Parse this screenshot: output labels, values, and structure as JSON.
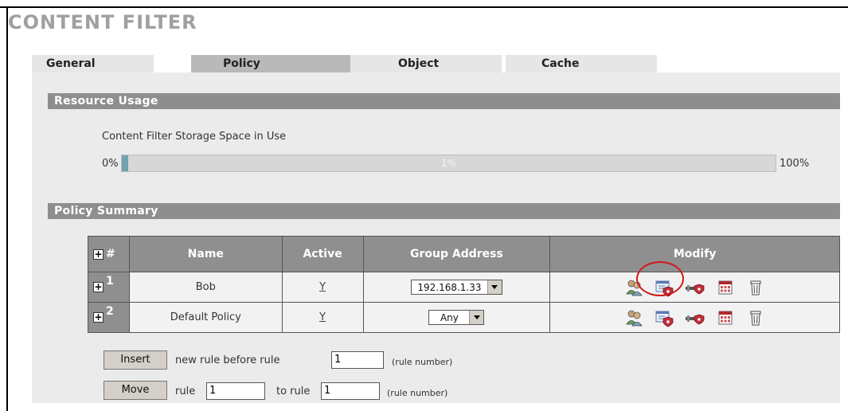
{
  "window": {
    "title": "CONTENT FILTER"
  },
  "tabs": [
    {
      "label": "General"
    },
    {
      "label": "Policy"
    },
    {
      "label": "Object"
    },
    {
      "label": "Cache"
    }
  ],
  "resource_usage": {
    "title": "Resource Usage",
    "storage_label": "Content Filter Storage Space in Use",
    "min_label": "0%",
    "max_label": "100%",
    "percent_text": "1%",
    "percent_value": 1
  },
  "policy_summary": {
    "title": "Policy Summary",
    "columns": {
      "num": "#",
      "name": "Name",
      "active": "Active",
      "group_address": "Group Address",
      "modify": "Modify"
    },
    "rows": [
      {
        "num": "1",
        "name": "Bob",
        "active": "Y",
        "group_address": "192.168.1.33"
      },
      {
        "num": "2",
        "name": "Default Policy",
        "active": "Y",
        "group_address": "Any"
      }
    ],
    "modify_icons": [
      "users-icon",
      "policy-schedule-icon",
      "key-security-icon",
      "calendar-icon",
      "trash-icon"
    ]
  },
  "insert_row": {
    "button": "Insert",
    "text": "new rule before rule",
    "value": "1",
    "hint": "(rule number)"
  },
  "move_row": {
    "button": "Move",
    "text_rule": "rule",
    "value_from": "1",
    "text_to": "to rule",
    "value_to": "1",
    "hint": "(rule number)"
  },
  "colors": {
    "highlight": "#d01818",
    "progress_fill": "#70a3ad",
    "section_bar": "#8e8e8e"
  }
}
